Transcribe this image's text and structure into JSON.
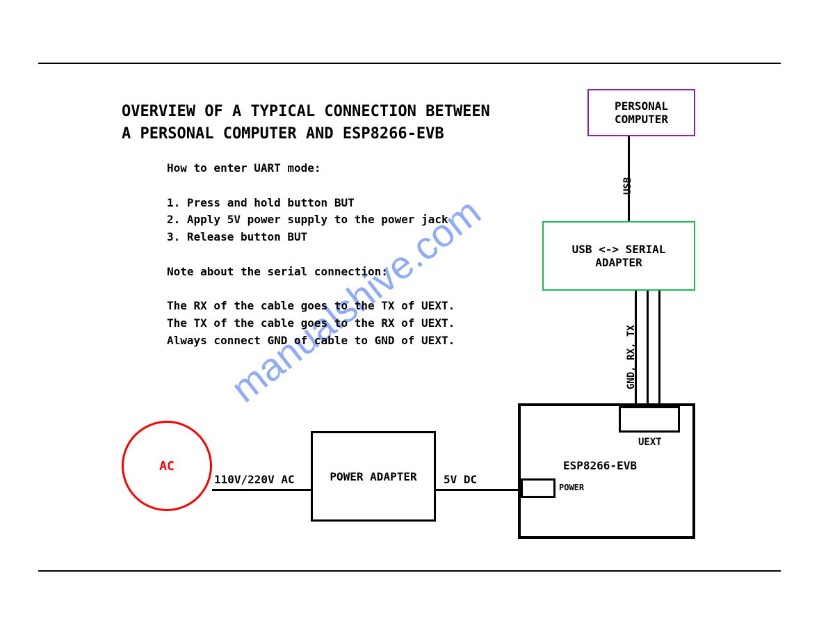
{
  "title": {
    "line1": "OVERVIEW OF A TYPICAL CONNECTION BETWEEN",
    "line2": "A PERSONAL COMPUTER AND ESP8266-EVB"
  },
  "instructions": {
    "heading": "How to enter UART mode:",
    "step1": "1. Press and hold button BUT",
    "step2": "2. Apply 5V power supply to the power jack",
    "step3": "3. Release button BUT",
    "note_heading": "Note about the serial connection:",
    "note1": "The RX of the cable goes to the TX of UEXT.",
    "note2": "The TX of the cable goes to the RX of UEXT.",
    "note3": "Always connect GND of cable to GND of UEXT."
  },
  "blocks": {
    "pc": "PERSONAL\nCOMPUTER",
    "usb_serial": "USB <-> SERIAL\nADAPTER",
    "power_adapter": "POWER ADAPTER",
    "evb": "ESP8266-EVB",
    "ac": "AC",
    "uext": "UEXT",
    "power_port": "POWER"
  },
  "connections": {
    "usb": "USB",
    "serial_lines": "GND, RX, TX",
    "ac_line": "110V/220V AC",
    "dc_line": "5V DC"
  },
  "watermark": "manualshive.com"
}
